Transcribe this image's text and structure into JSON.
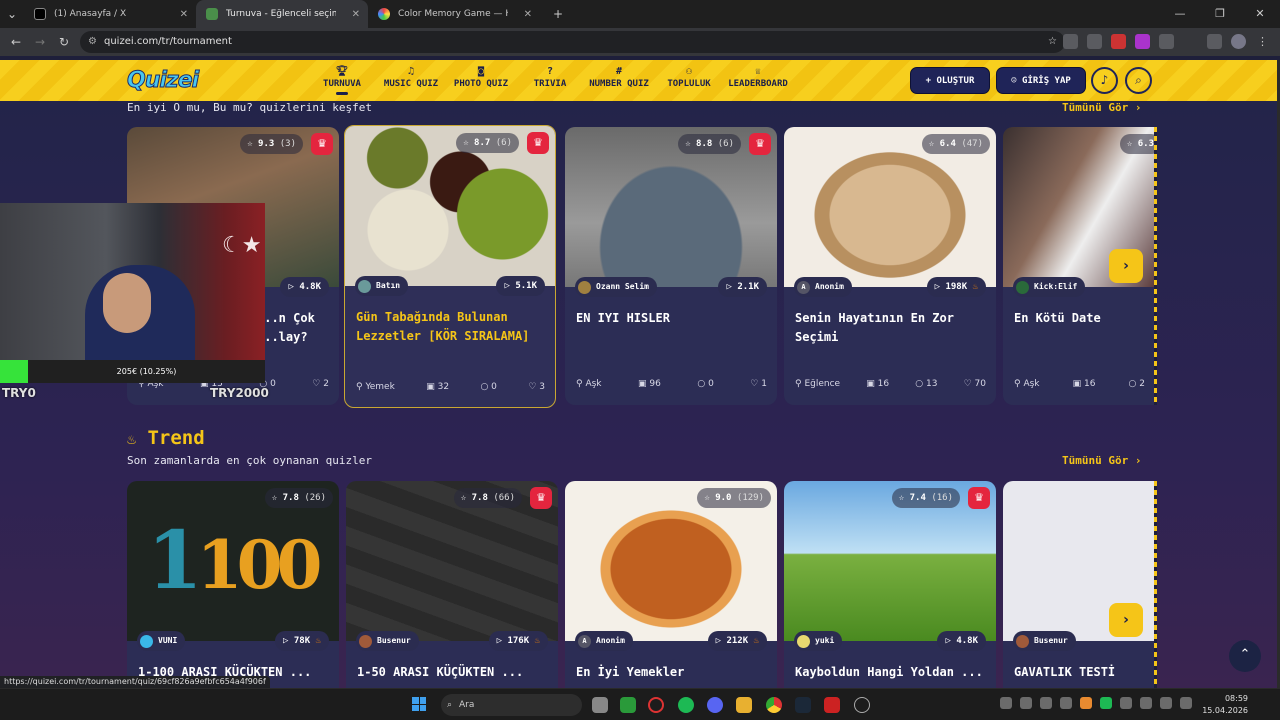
{
  "browser": {
    "tabs": [
      {
        "title": "(1) Anasayfa / X",
        "active": false
      },
      {
        "title": "Turnuva - Eğlenceli seçimler yap",
        "active": true
      },
      {
        "title": "Color Memory Game — How W",
        "active": false
      }
    ],
    "url": "quizei.com/tr/tournament",
    "status_url": "https://quizei.com/tr/tournament/quiz/69cf826a9efbfc654a4f906f"
  },
  "site": {
    "logo": "Quizei",
    "nav": [
      {
        "label": "TURNUVA",
        "icon": "trophy-icon",
        "active": true
      },
      {
        "label": "MUSIC QUIZ",
        "icon": "music-icon"
      },
      {
        "label": "PHOTO QUIZ",
        "icon": "camera-icon"
      },
      {
        "label": "TRIVIA",
        "icon": "question-icon"
      },
      {
        "label": "NUMBER QUIZ",
        "icon": "hash-icon"
      },
      {
        "label": "TOPLULUK",
        "icon": "users-icon"
      },
      {
        "label": "LEADERBOARD",
        "icon": "medal-icon"
      }
    ],
    "create_label": "OLUŞTUR",
    "login_label": "GİRİŞ YAP"
  },
  "section1": {
    "subtitle": "En iyi O mu, Bu mu? quizlerini keşfet",
    "see_all": "Tümünü Gör",
    "cards": [
      {
        "rating": "9.3",
        "count": "(3)",
        "plays": "4.8K",
        "author": "",
        "title": "...n Çok ...lay?",
        "category": "Aşk",
        "questions": "15",
        "comments": "0",
        "likes": "2",
        "crown": true
      },
      {
        "rating": "8.7",
        "count": "(6)",
        "plays": "5.1K",
        "author": "Batın",
        "title": "Gün Tabağında Bulunan Lezzetler [KÖR SIRALAMA]",
        "category": "Yemek",
        "questions": "32",
        "comments": "0",
        "likes": "3",
        "crown": true
      },
      {
        "rating": "8.8",
        "count": "(6)",
        "plays": "2.1K",
        "author": "Ozann Selim",
        "title": "EN IYI HISLER",
        "category": "Aşk",
        "questions": "96",
        "comments": "0",
        "likes": "1",
        "crown": true
      },
      {
        "rating": "6.4",
        "count": "(47)",
        "plays": "198K",
        "author": "Anonim",
        "title": "Senin Hayatının En Zor Seçimi",
        "category": "Eğlence",
        "questions": "16",
        "comments": "13",
        "likes": "70",
        "crown": false
      },
      {
        "rating": "6.3",
        "count": "",
        "plays": "",
        "author": "Kick:Elif",
        "title": "En Kötü Date",
        "category": "Aşk",
        "questions": "16",
        "comments": "2",
        "likes": "",
        "crown": false
      }
    ]
  },
  "section2": {
    "title": "Trend",
    "subtitle": "Son zamanlarda en çok oynanan quizler",
    "see_all": "Tümünü Gör",
    "cards": [
      {
        "rating": "7.8",
        "count": "(26)",
        "plays": "78K",
        "author": "VUNI",
        "title": "1-100 ARASI KÜÇÜKTEN ...",
        "crown": false
      },
      {
        "rating": "7.8",
        "count": "(66)",
        "plays": "176K",
        "author": "Busenur",
        "title": "1-50 ARASI KÜÇÜKTEN ...",
        "crown": true
      },
      {
        "rating": "9.0",
        "count": "(129)",
        "plays": "212K",
        "author": "Anonim",
        "title": "En İyi Yemekler",
        "crown": false
      },
      {
        "rating": "7.4",
        "count": "(16)",
        "plays": "4.8K",
        "author": "yuki",
        "title": "Kayboldun Hangi Yoldan ...",
        "crown": true
      },
      {
        "rating": "",
        "count": "",
        "plays": "",
        "author": "Busenur",
        "title": "GAVATLIK TESTİ",
        "crown": false
      }
    ]
  },
  "overlay": {
    "stat": "205€ (10.25%)",
    "try_left": "TRY0",
    "try_right": "TRY2000"
  },
  "taskbar": {
    "search_placeholder": "Ara",
    "time": "08:59",
    "date": "15.04.2026"
  }
}
